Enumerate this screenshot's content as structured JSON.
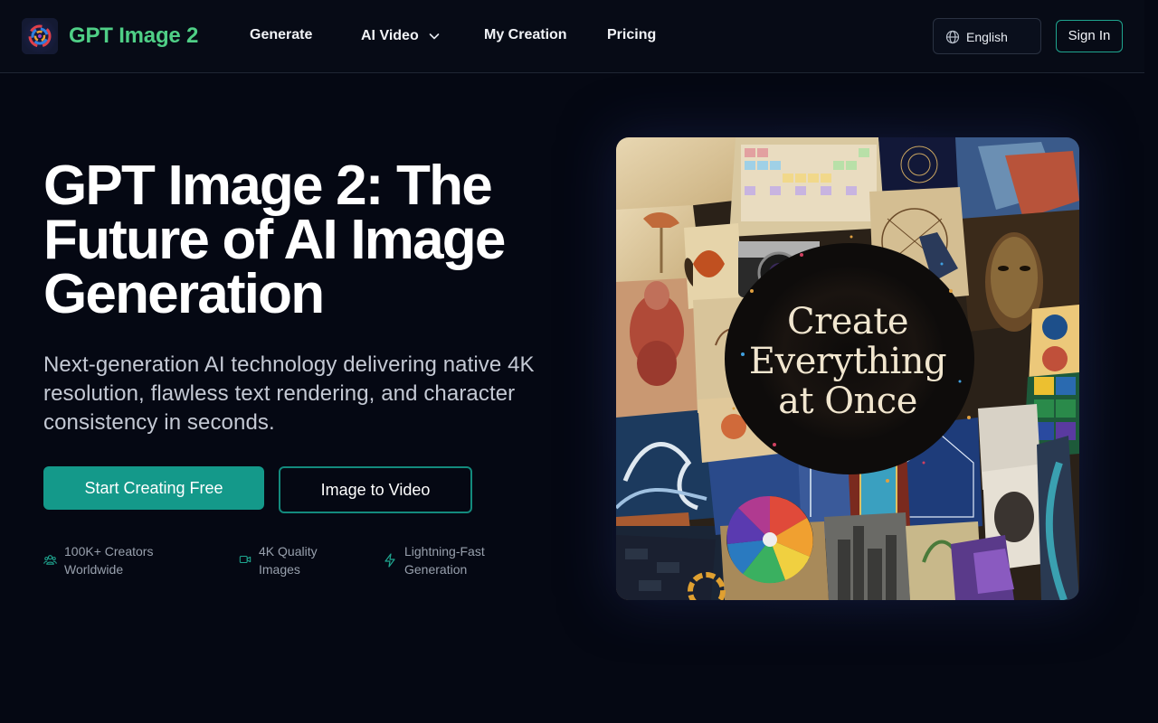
{
  "header": {
    "brand": "GPT Image 2",
    "nav": {
      "generate": "Generate",
      "ai_video": "AI Video",
      "my_creation": "My Creation",
      "pricing": "Pricing"
    },
    "language": "English",
    "sign_in": "Sign In"
  },
  "hero": {
    "title": "GPT Image 2: The Future of AI Image Generation",
    "subtitle": "Next-generation AI technology delivering native 4K resolution, flawless text rendering, and character consistency in seconds.",
    "primary_cta": "Start Creating Free",
    "secondary_cta": "Image to Video",
    "features": [
      {
        "icon": "users-icon",
        "line1": "100K+ Creators",
        "line2": "Worldwide"
      },
      {
        "icon": "video-icon",
        "line1": "4K Quality",
        "line2": "Images"
      },
      {
        "icon": "lightning-icon",
        "line1": "Lightning-Fast",
        "line2": "Generation"
      }
    ],
    "image_caption": [
      "Create",
      "Everything",
      "at Once"
    ]
  },
  "colors": {
    "background": "#050813",
    "brand_green": "#4fcf86",
    "accent_teal": "#14998a"
  }
}
